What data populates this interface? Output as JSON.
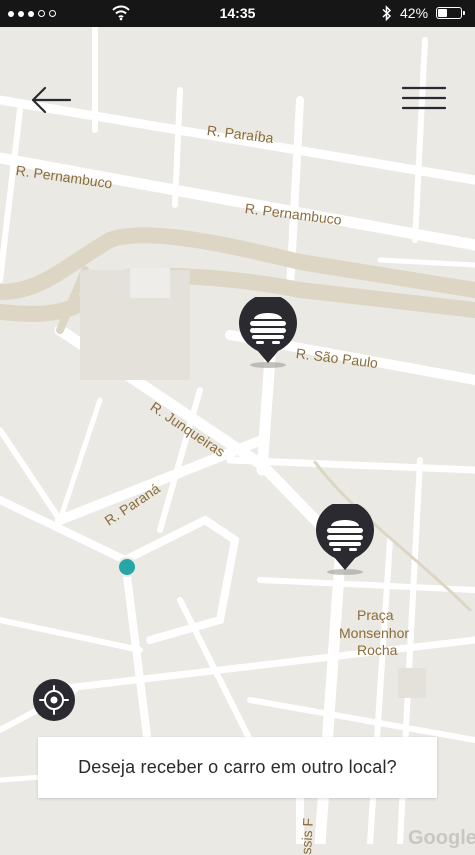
{
  "status_bar": {
    "time": "14:35",
    "battery_text": "42%",
    "battery_level": 0.42,
    "signal_dots_filled": 3,
    "signal_dots_total": 5
  },
  "map": {
    "streets": {
      "paraiba": "R. Paraíba",
      "pernambuco_1": "R. Pernambuco",
      "pernambuco_2": "R. Pernambuco",
      "sao_paulo": "R. São Paulo",
      "junqueiras": "R. Junqueiras",
      "parana": "R. Paraná",
      "praca_1": "Praça",
      "praca_2": "Monsenhor",
      "praca_3": "Rocha",
      "bottom_street": "ssis F"
    },
    "attribution": "Google",
    "colors": {
      "background": "#ebe9e4",
      "road": "#ffffff",
      "major_road": "#ddd6c4",
      "label": "#8a6d3b",
      "user_location": "#26a7a7",
      "pin": "#2b2a30"
    }
  },
  "controls": {
    "back_icon": "arrow-left-icon",
    "menu_icon": "hamburger-menu-icon",
    "locate_icon": "crosshair-location-icon",
    "car_pin_icon": "car-pin-icon"
  },
  "prompt": {
    "text": "Deseja receber o carro em outro local?"
  }
}
